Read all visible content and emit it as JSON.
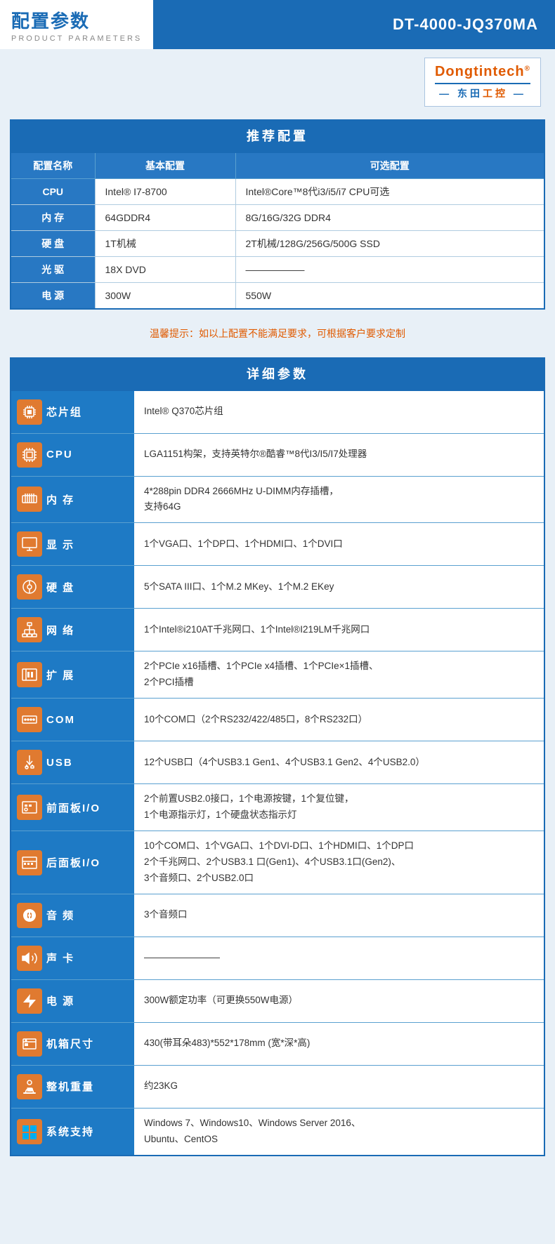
{
  "header": {
    "title_main": "配置参数",
    "title_sub": "PRODUCT PARAMETERS",
    "model": "DT-4000-JQ370MA"
  },
  "logo": {
    "name_main": "Dongtintech",
    "name_reg": "®",
    "divider": true,
    "name_sub": "— 东田工控 —"
  },
  "recommend": {
    "section_title": "推荐配置",
    "columns": [
      "配置名称",
      "基本配置",
      "可选配置"
    ],
    "rows": [
      {
        "name": "CPU",
        "basic": "Intel® I7-8700",
        "optional": "Intel®Core™8代i3/i5/i7 CPU可选"
      },
      {
        "name": "内 存",
        "basic": "64GDDR4",
        "optional": "8G/16G/32G DDR4"
      },
      {
        "name": "硬 盘",
        "basic": "1T机械",
        "optional": "2T机械/128G/256G/500G SSD"
      },
      {
        "name": "光 驱",
        "basic": "18X DVD",
        "optional": "——————"
      },
      {
        "name": "电 源",
        "basic": "300W",
        "optional": "550W"
      }
    ]
  },
  "warning": "温馨提示：如以上配置不能满足要求，可根据客户要求定制",
  "detail": {
    "section_title": "详细参数",
    "rows": [
      {
        "icon_type": "chip",
        "label": "芯片组",
        "value": "Intel® Q370芯片组"
      },
      {
        "icon_type": "cpu",
        "label": "CPU",
        "value": "LGA1151构架，支持英特尔®酷睿™8代I3/I5/I7处理器"
      },
      {
        "icon_type": "memory",
        "label": "内 存",
        "value": "4*288pin DDR4 2666MHz U-DIMM内存插槽，\n支持64G"
      },
      {
        "icon_type": "display",
        "label": "显 示",
        "value": "1个VGA口、1个DP口、1个HDMI口、1个DVI口"
      },
      {
        "icon_type": "hdd",
        "label": "硬 盘",
        "value": "5个SATA III口、1个M.2 MKey、1个M.2 EKey"
      },
      {
        "icon_type": "network",
        "label": "网 络",
        "value": "1个Intel®i210AT千兆网口、1个Intel®I219LM千兆网口"
      },
      {
        "icon_type": "expand",
        "label": "扩 展",
        "value": "2个PCIe x16插槽、1个PCIe x4插槽、1个PCIe×1插槽、\n2个PCI插槽"
      },
      {
        "icon_type": "com",
        "label": "COM",
        "value": "10个COM口（2个RS232/422/485口，8个RS232口）"
      },
      {
        "icon_type": "usb",
        "label": "USB",
        "value": "12个USB口（4个USB3.1 Gen1、4个USB3.1 Gen2、4个USB2.0）"
      },
      {
        "icon_type": "frontio",
        "label": "前面板I/O",
        "value": "2个前置USB2.0接口，1个电源按键，1个复位键，\n1个电源指示灯，1个硬盘状态指示灯"
      },
      {
        "icon_type": "reario",
        "label": "后面板I/O",
        "value": "10个COM口、1个VGA口、1个DVI-D口、1个HDMI口、1个DP口\n2个千兆网口、2个USB3.1 口(Gen1)、4个USB3.1口(Gen2)、\n3个音频口、2个USB2.0口"
      },
      {
        "icon_type": "audio",
        "label": "音 频",
        "value": "3个音频口"
      },
      {
        "icon_type": "soundcard",
        "label": "声 卡",
        "value": "————————"
      },
      {
        "icon_type": "power",
        "label": "电 源",
        "value": "300W额定功率（可更换550W电源）"
      },
      {
        "icon_type": "chassis",
        "label": "机箱尺寸",
        "value": "430(带耳朵483)*552*178mm (宽*深*高)"
      },
      {
        "icon_type": "weight",
        "label": "整机重量",
        "value": "约23KG"
      },
      {
        "icon_type": "os",
        "label": "系统支持",
        "value": "Windows 7、Windows10、Windows Server 2016、\nUbuntu、CentOS"
      }
    ]
  }
}
